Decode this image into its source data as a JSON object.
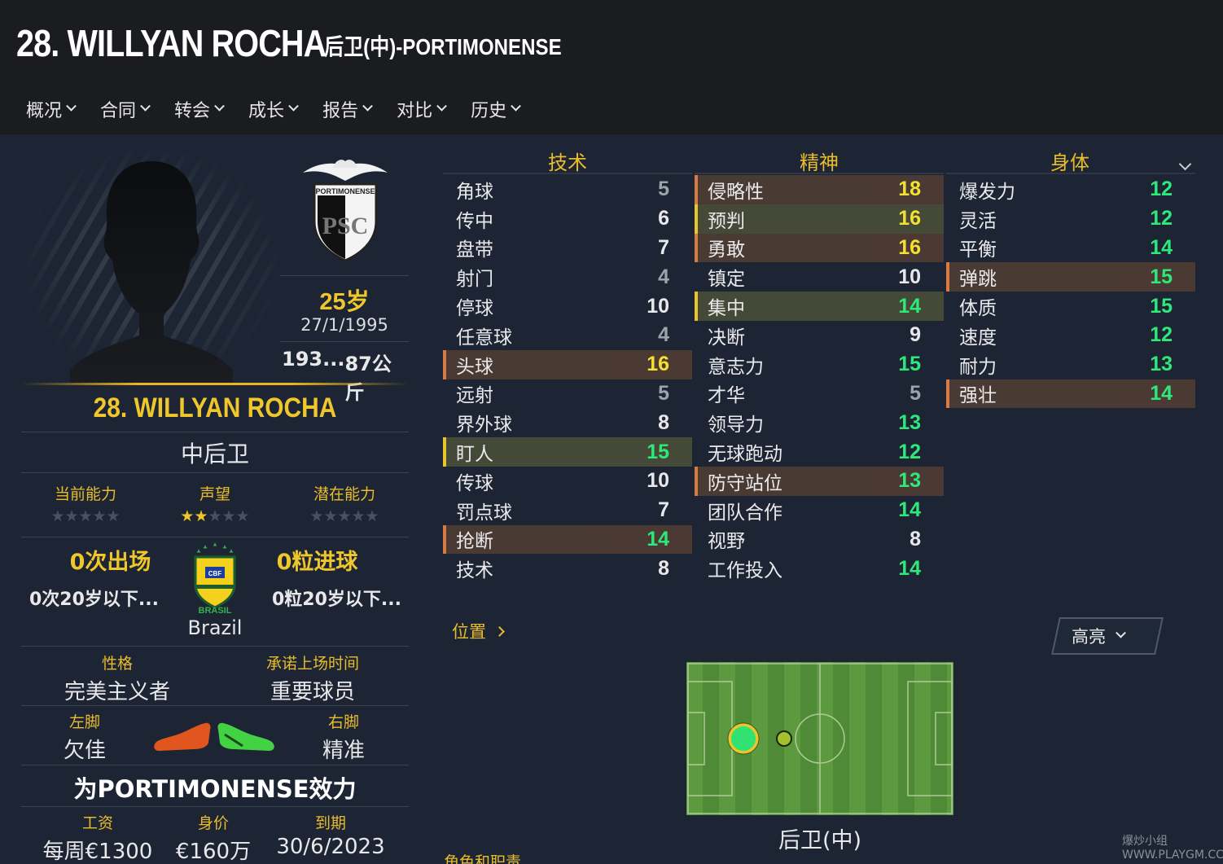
{
  "header": {
    "title": "28. WILLYAN ROCHA",
    "subtitle": "后卫(中)-PORTIMONENSE"
  },
  "nav": [
    "概况",
    "合同",
    "转会",
    "成长",
    "报告",
    "对比",
    "历史"
  ],
  "profile": {
    "club_badge_text": "PORTIMONENSE",
    "club_badge_monogram": "PSC",
    "age": "25岁",
    "dob": "27/1/1995",
    "height": "193...",
    "weight": "87公斤",
    "name": "28. WILLYAN ROCHA",
    "position": "中后卫",
    "ability_labels": [
      "当前能力",
      "声望",
      "潜在能力"
    ],
    "ability_stars": [
      0,
      2,
      0
    ],
    "apps": "0次出场",
    "apps_u20": "0次20岁以下...",
    "goals": "0粒进球",
    "goals_u20": "0粒20岁以下...",
    "flag_text": "BRASIL",
    "flag_badge_text": "CBF",
    "country": "Brazil",
    "personality_label": "性格",
    "personality": "完美主义者",
    "playing_time_label": "承诺上场时间",
    "playing_time": "重要球员",
    "left_foot_label": "左脚",
    "left_foot": "欠佳",
    "right_foot_label": "右脚",
    "right_foot": "精准",
    "plays_for": "为PORTIMONENSE效力",
    "wage_label": "工资",
    "wage": "每周€1300",
    "value_label": "身价",
    "value": "€160万",
    "expiry_label": "到期",
    "expiry": "30/6/2023"
  },
  "attributes": {
    "technical_title": "技术",
    "mental_title": "精神",
    "physical_title": "身体",
    "technical": [
      {
        "name": "角球",
        "value": "5",
        "hl": ""
      },
      {
        "name": "传中",
        "value": "6",
        "hl": ""
      },
      {
        "name": "盘带",
        "value": "7",
        "hl": ""
      },
      {
        "name": "射门",
        "value": "4",
        "hl": ""
      },
      {
        "name": "停球",
        "value": "10",
        "hl": ""
      },
      {
        "name": "任意球",
        "value": "4",
        "hl": ""
      },
      {
        "name": "头球",
        "value": "16",
        "hl": "red"
      },
      {
        "name": "远射",
        "value": "5",
        "hl": ""
      },
      {
        "name": "界外球",
        "value": "8",
        "hl": ""
      },
      {
        "name": "盯人",
        "value": "15",
        "hl": "yel"
      },
      {
        "name": "传球",
        "value": "10",
        "hl": ""
      },
      {
        "name": "罚点球",
        "value": "7",
        "hl": ""
      },
      {
        "name": "抢断",
        "value": "14",
        "hl": "red"
      },
      {
        "name": "技术",
        "value": "8",
        "hl": ""
      }
    ],
    "mental": [
      {
        "name": "侵略性",
        "value": "18",
        "hl": "red"
      },
      {
        "name": "预判",
        "value": "16",
        "hl": "yel"
      },
      {
        "name": "勇敢",
        "value": "16",
        "hl": "red"
      },
      {
        "name": "镇定",
        "value": "10",
        "hl": ""
      },
      {
        "name": "集中",
        "value": "14",
        "hl": "yel"
      },
      {
        "name": "决断",
        "value": "9",
        "hl": ""
      },
      {
        "name": "意志力",
        "value": "15",
        "hl": ""
      },
      {
        "name": "才华",
        "value": "5",
        "hl": ""
      },
      {
        "name": "领导力",
        "value": "13",
        "hl": ""
      },
      {
        "name": "无球跑动",
        "value": "12",
        "hl": ""
      },
      {
        "name": "防守站位",
        "value": "13",
        "hl": "red"
      },
      {
        "name": "团队合作",
        "value": "14",
        "hl": ""
      },
      {
        "name": "视野",
        "value": "8",
        "hl": ""
      },
      {
        "name": "工作投入",
        "value": "14",
        "hl": ""
      }
    ],
    "physical": [
      {
        "name": "爆发力",
        "value": "12",
        "hl": ""
      },
      {
        "name": "灵活",
        "value": "12",
        "hl": ""
      },
      {
        "name": "平衡",
        "value": "14",
        "hl": ""
      },
      {
        "name": "弹跳",
        "value": "15",
        "hl": "red"
      },
      {
        "name": "体质",
        "value": "15",
        "hl": ""
      },
      {
        "name": "速度",
        "value": "12",
        "hl": ""
      },
      {
        "name": "耐力",
        "value": "13",
        "hl": ""
      },
      {
        "name": "强壮",
        "value": "14",
        "hl": "red"
      }
    ]
  },
  "positions": {
    "link": "位置",
    "highlight_button": "高亮",
    "pitch_label": "后卫(中)",
    "roles_label": "角色和职责"
  },
  "watermark": "爆炒小组 WWW.PLAYGM.CC"
}
